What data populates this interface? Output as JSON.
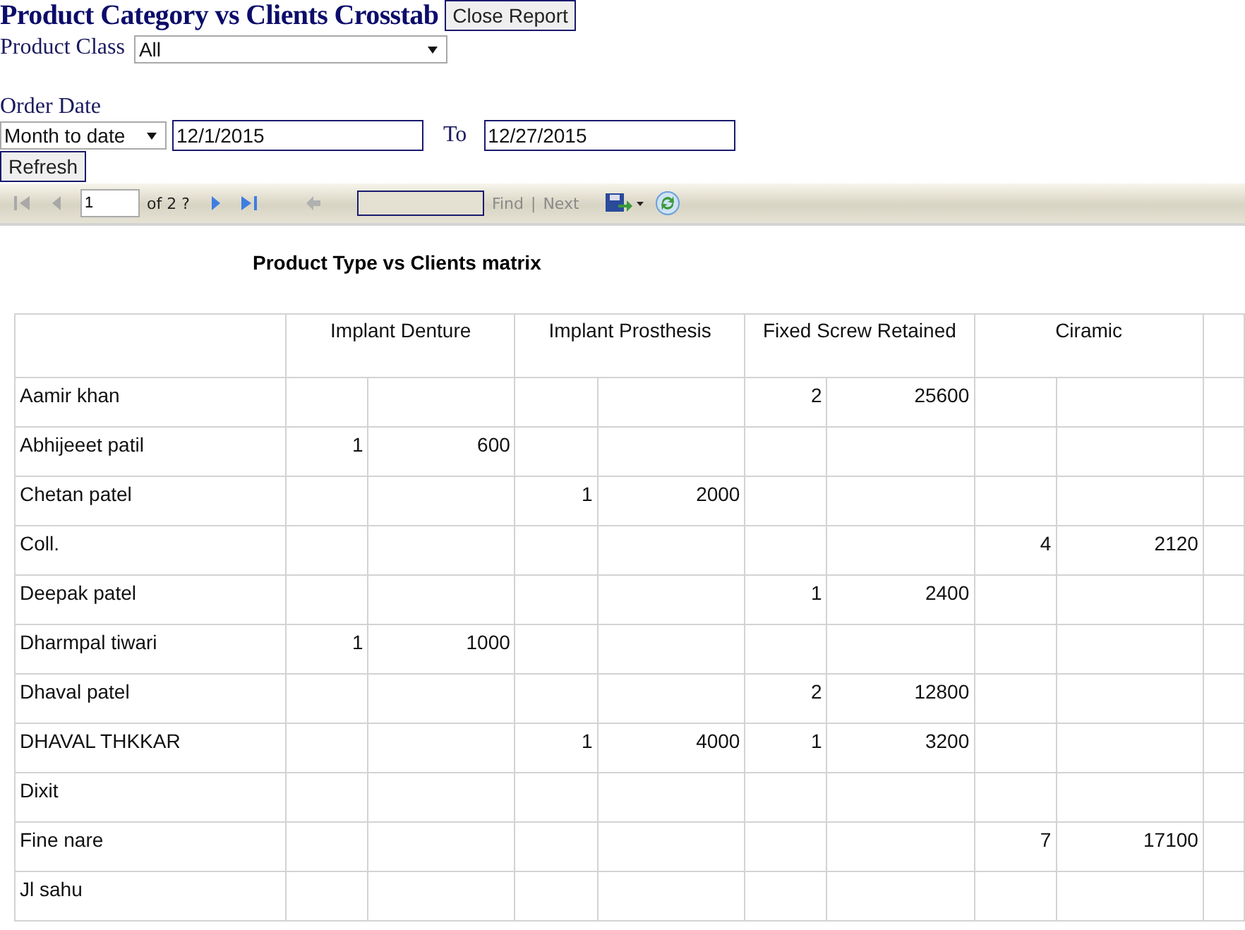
{
  "title": "Product Category vs Clients Crosstab",
  "close_button": "Close Report",
  "product_class": {
    "label": "Product Class",
    "value": "All"
  },
  "order_date": {
    "label": "Order Date",
    "range": "Month to date",
    "from": "12/1/2015",
    "to_label": "To",
    "to": "12/27/2015"
  },
  "refresh_button": "Refresh",
  "toolbar": {
    "page": "1",
    "page_count": "of 2 ?",
    "find": "Find",
    "separator": "|",
    "next": "Next"
  },
  "report": {
    "title": "Product Type vs Clients matrix",
    "categories": [
      "Implant Denture",
      "Implant Prosthesis",
      "Fixed Screw Retained",
      "Ciramic"
    ],
    "rows": [
      {
        "name": "Aamir khan",
        "cells": [
          null,
          null,
          null,
          null,
          "2",
          "25600",
          null,
          null
        ]
      },
      {
        "name": "Abhijeeet patil",
        "cells": [
          "1",
          "600",
          null,
          null,
          null,
          null,
          null,
          null
        ]
      },
      {
        "name": "Chetan patel",
        "cells": [
          null,
          null,
          "1",
          "2000",
          null,
          null,
          null,
          null
        ]
      },
      {
        "name": "Coll.",
        "cells": [
          null,
          null,
          null,
          null,
          null,
          null,
          "4",
          "2120"
        ]
      },
      {
        "name": "Deepak patel",
        "cells": [
          null,
          null,
          null,
          null,
          "1",
          "2400",
          null,
          null
        ]
      },
      {
        "name": "Dharmpal tiwari",
        "cells": [
          "1",
          "1000",
          null,
          null,
          null,
          null,
          null,
          null
        ]
      },
      {
        "name": "Dhaval patel",
        "cells": [
          null,
          null,
          null,
          null,
          "2",
          "12800",
          null,
          null
        ]
      },
      {
        "name": "DHAVAL THKKAR",
        "cells": [
          null,
          null,
          "1",
          "4000",
          "1",
          "3200",
          null,
          null
        ]
      },
      {
        "name": "Dixit",
        "cells": [
          null,
          null,
          null,
          null,
          null,
          null,
          null,
          null
        ]
      },
      {
        "name": "Fine nare",
        "cells": [
          null,
          null,
          null,
          null,
          null,
          null,
          "7",
          "17100"
        ]
      },
      {
        "name": "Jl sahu",
        "cells": [
          null,
          null,
          null,
          null,
          null,
          null,
          null,
          null
        ]
      }
    ]
  }
}
